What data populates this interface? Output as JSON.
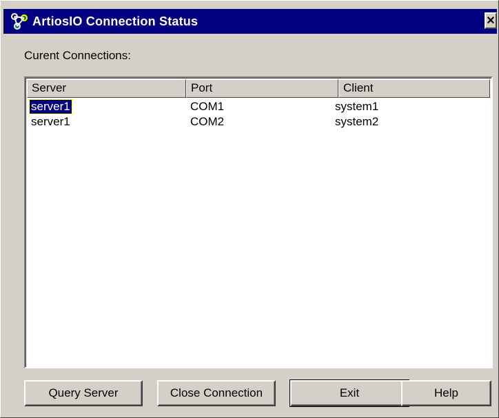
{
  "window": {
    "title": "ArtiosIO Connection Status",
    "close_label": "✕"
  },
  "caption": "Curent Connections:",
  "list": {
    "columns": [
      "Server",
      "Port",
      "Client"
    ],
    "rows": [
      {
        "server": "server1",
        "port": "COM1",
        "client": "system1",
        "selected": true
      },
      {
        "server": "server1",
        "port": "COM2",
        "client": "system2",
        "selected": false
      }
    ]
  },
  "buttons": {
    "query": "Query Server",
    "close_conn": "Close Connection",
    "exit": "Exit",
    "help": "Help"
  },
  "colors": {
    "titlebar": "#000080",
    "face": "#d4d0c8",
    "selection": "#000080"
  }
}
